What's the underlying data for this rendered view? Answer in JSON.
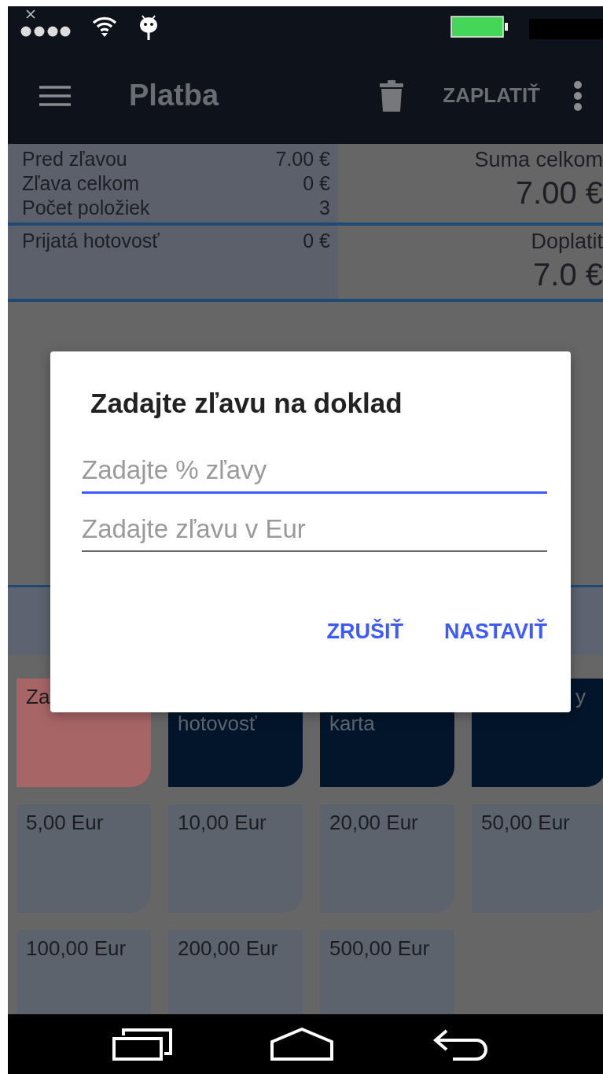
{
  "app_bar": {
    "title": "Platba",
    "action": "ZAPLATIŤ"
  },
  "summary": {
    "rows": [
      {
        "label": "Pred zľavou",
        "value": "7.00 €"
      },
      {
        "label": "Zľava celkom",
        "value": "0 €"
      },
      {
        "label": "Počet položiek",
        "value": "3"
      }
    ],
    "total_label": "Suma celkom",
    "total_value": "7.00 €",
    "paid_label": "Prijatá hotovosť",
    "paid_value": "0 €",
    "due_label": "Doplatit",
    "due_value": "7.0 €"
  },
  "payment_tiles": [
    {
      "kind": "cancel",
      "label": "Za"
    },
    {
      "kind": "method",
      "label": "hotovosť"
    },
    {
      "kind": "method",
      "label": "karta"
    },
    {
      "kind": "voucher",
      "label": "y"
    }
  ],
  "amount_buttons": [
    "5,00 Eur",
    "10,00 Eur",
    "20,00 Eur",
    "50,00 Eur",
    "100,00 Eur",
    "200,00 Eur",
    "500,00 Eur"
  ],
  "dialog": {
    "title": "Zadajte zľavu na doklad",
    "fields": [
      {
        "placeholder": "Zadajte % zľavy",
        "focused": true
      },
      {
        "placeholder": "Zadajte zľavu v Eur",
        "focused": false
      }
    ],
    "buttons": [
      "ZRUŠIŤ",
      "NASTAVIŤ"
    ]
  }
}
